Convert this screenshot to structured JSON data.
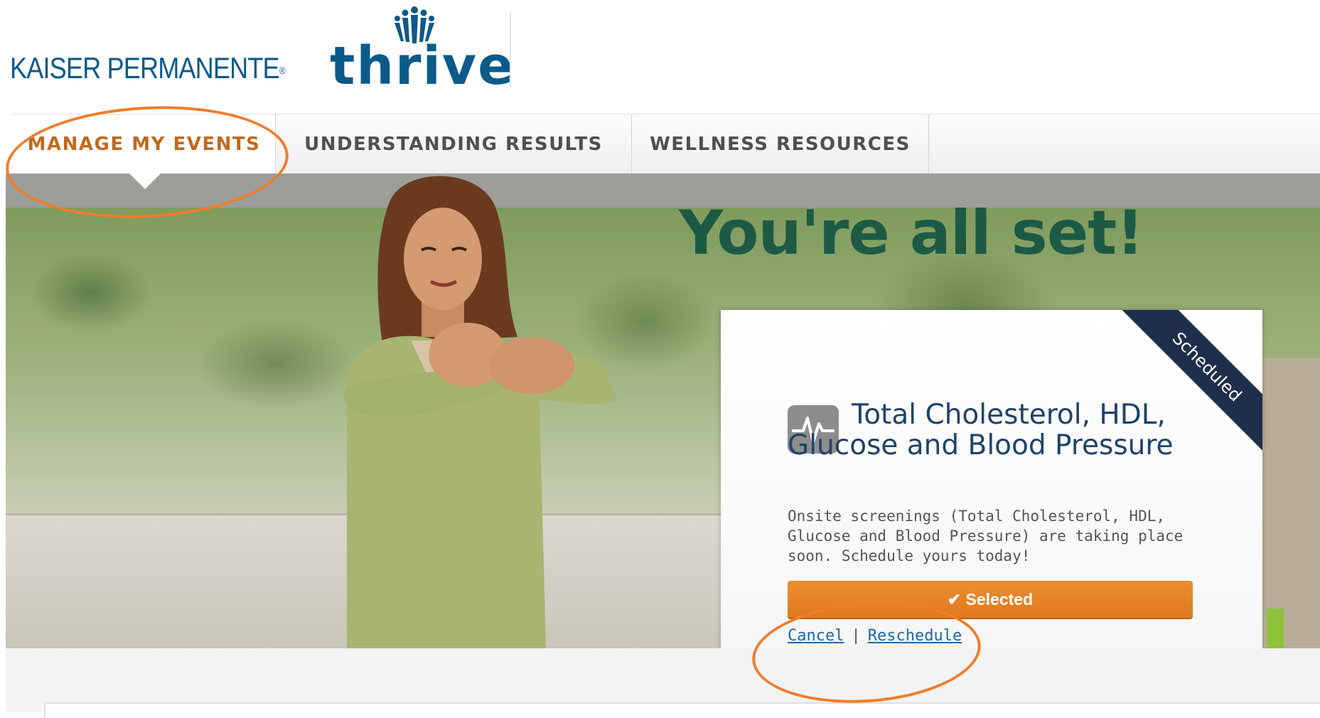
{
  "header": {
    "brand_name": "KAISER PERMANENTE",
    "brand_mark": "®",
    "product_name": "thrive"
  },
  "nav": {
    "tabs": [
      {
        "label": "MANAGE MY EVENTS",
        "active": true
      },
      {
        "label": "UNDERSTANDING RESULTS",
        "active": false
      },
      {
        "label": "WELLNESS RESOURCES",
        "active": false
      }
    ]
  },
  "hero": {
    "headline": "You're all set!"
  },
  "card": {
    "ribbon": "Scheduled",
    "icon": "heartbeat-icon",
    "title": "Total Cholesterol, HDL, Glucose and Blood Pressure",
    "description": "Onsite screenings (Total Cholesterol, HDL, Glucose and Blood Pressure) are taking place soon. Schedule yours today!",
    "button": {
      "check": "✔",
      "label": "Selected"
    },
    "links": {
      "cancel": "Cancel",
      "separator": "|",
      "reschedule": "Reschedule"
    }
  },
  "colors": {
    "brand_blue": "#0b5a8a",
    "active_tab": "#c06a1e",
    "headline": "#1d5a45",
    "ribbon": "#1e2f4c",
    "button": "#e2801f",
    "link": "#1e69a8",
    "annotation": "#f07d2b"
  }
}
